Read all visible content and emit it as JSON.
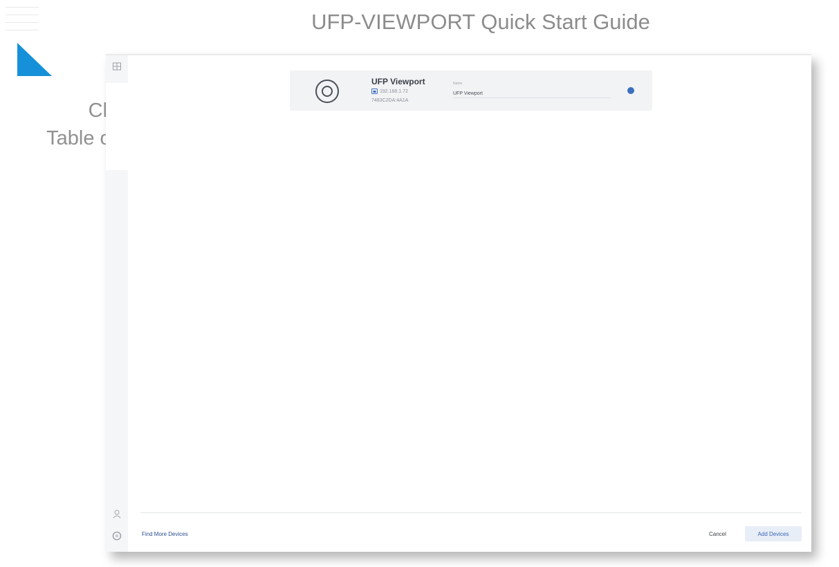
{
  "guide": {
    "title": "UFP-VIEWPORT Quick Start Guide",
    "toc_line1": "Click for",
    "toc_line2": "Table of Contents",
    "close_glyph": "×"
  },
  "sidebar": {
    "icons": [
      "grid-icon",
      "user-icon",
      "settings-icon"
    ]
  },
  "device": {
    "name": "UFP Viewport",
    "ip": "192.168.1.72",
    "mac": "7483C2DA:4A1A",
    "name_field_label": "Name",
    "name_field_value": "UFP Viewport",
    "selected": true
  },
  "footer": {
    "find_more_label": "Find More Devices",
    "cancel_label": "Cancel",
    "add_devices_label": "Add Devices"
  },
  "colors": {
    "accent": "#3d6fbe",
    "toc_triangle": "#1690d8",
    "card_bg": "#f2f3f5"
  }
}
